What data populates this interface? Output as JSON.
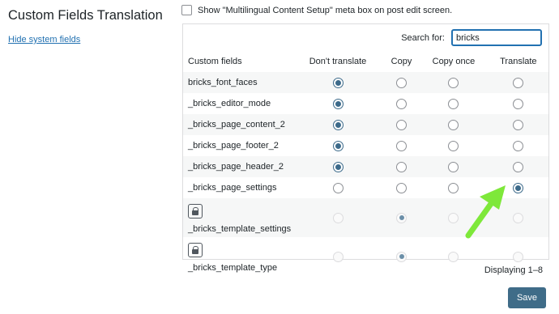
{
  "page": {
    "title": "Custom Fields Translation",
    "hide_link": "Hide system fields",
    "metabox_label": "Show \"Multilingual Content Setup\" meta box on post edit screen."
  },
  "search": {
    "label": "Search for:",
    "value": "bricks"
  },
  "table": {
    "headers": [
      "Custom fields",
      "Don't translate",
      "Copy",
      "Copy once",
      "Translate"
    ],
    "rows": [
      {
        "name": "bricks_font_faces",
        "selected": 0,
        "locked": false
      },
      {
        "name": "_bricks_editor_mode",
        "selected": 0,
        "locked": false
      },
      {
        "name": "_bricks_page_content_2",
        "selected": 0,
        "locked": false
      },
      {
        "name": "_bricks_page_footer_2",
        "selected": 0,
        "locked": false
      },
      {
        "name": "_bricks_page_header_2",
        "selected": 0,
        "locked": false
      },
      {
        "name": "_bricks_page_settings",
        "selected": 3,
        "locked": false
      },
      {
        "name": "_bricks_template_settings",
        "selected": 1,
        "locked": true
      },
      {
        "name": "_bricks_template_type",
        "selected": 1,
        "locked": true
      }
    ]
  },
  "footer": {
    "displaying": "Displaying 1–8",
    "save_label": "Save"
  },
  "colors": {
    "accent": "#2271b1",
    "save_bg": "#3f6c88",
    "arrow": "#7ee83a"
  }
}
